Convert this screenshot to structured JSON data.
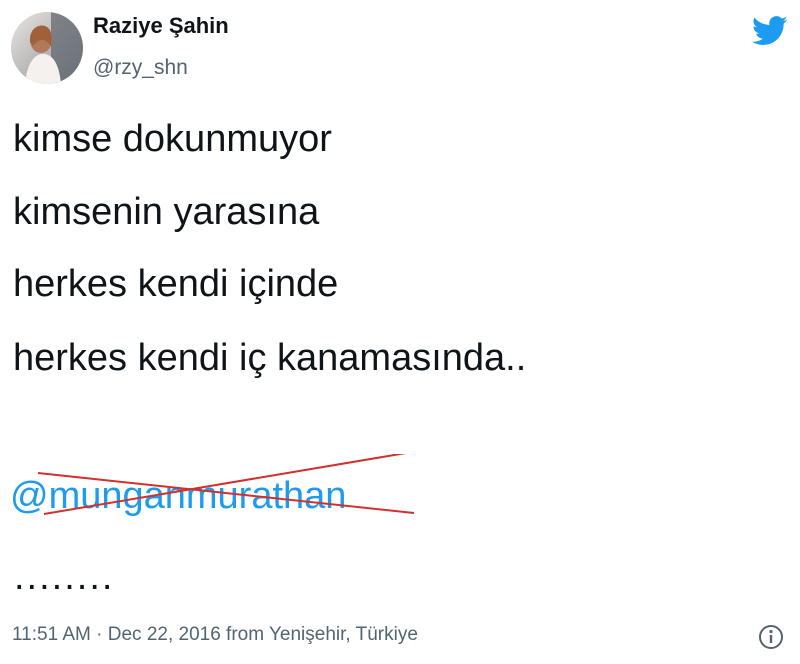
{
  "author": {
    "name": "Raziye Şahin",
    "handle": "@rzy_shn",
    "avatar_icon": "profile-photo"
  },
  "brand": {
    "icon": "twitter-bird-icon",
    "color": "#1d9bf0"
  },
  "tweet": {
    "lines": [
      "kimse dokunmuyor",
      "kimsenin yarasına",
      "herkes kendi içinde",
      "herkes kendi iç kanamasında.."
    ],
    "mention": "@munganmurathan",
    "mention_color": "#1d9bf0",
    "strike_color": "#d32f2f",
    "ellipsis": "........"
  },
  "meta": {
    "timestamp": "11:51 AM · Dec 22, 2016 from Yenişehir, Türkiye",
    "info_icon": "info-icon"
  }
}
